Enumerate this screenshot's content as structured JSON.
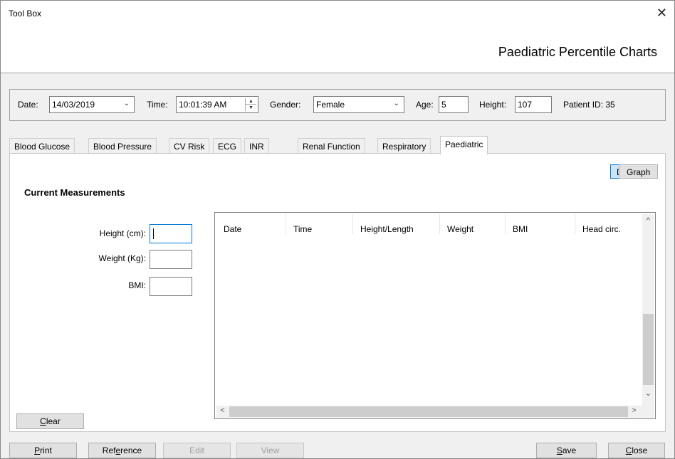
{
  "window": {
    "title": "Tool Box",
    "close_icon": "close-icon"
  },
  "header": {
    "title": "Paediatric Percentile Charts"
  },
  "filters": {
    "date_label": "Date:",
    "date_value": "14/03/2019",
    "time_label": "Time:",
    "time_value": "10:01:39 AM",
    "gender_label": "Gender:",
    "gender_value": "Female",
    "age_label": "Age:",
    "age_value": "5",
    "height_label": "Height:",
    "height_value": "107",
    "patient_id_label": "Patient ID: 35"
  },
  "tabs": [
    {
      "label": "Blood Glucose"
    },
    {
      "label": "Blood Pressure"
    },
    {
      "label": "CV Risk"
    },
    {
      "label": "ECG"
    },
    {
      "label": "INR"
    },
    {
      "label": "Renal Function"
    },
    {
      "label": "Respiratory"
    },
    {
      "label": "Paediatric",
      "active": true
    }
  ],
  "view_toggle": {
    "data_label": "Data",
    "graph_label": "Graph",
    "selected": "Data"
  },
  "measurements": {
    "title": "Current Measurements",
    "height_label": "Height (cm):",
    "weight_label": "Weight (Kg):",
    "bmi_label": "BMI:",
    "height_value": "",
    "weight_value": "",
    "bmi_value": ""
  },
  "table": {
    "columns": [
      "Date",
      "Time",
      "Height/Length",
      "Weight",
      "BMI",
      "Head circ."
    ],
    "rows": []
  },
  "buttons": {
    "clear": {
      "pre": "",
      "u": "C",
      "post": "lear"
    },
    "print": {
      "pre": "",
      "u": "P",
      "post": "rint"
    },
    "reference": {
      "pre": "Ref",
      "u": "e",
      "post": "rence"
    },
    "edit": "Edit",
    "view": "View",
    "save": {
      "pre": "",
      "u": "S",
      "post": "ave"
    },
    "close": {
      "pre": "",
      "u": "C",
      "post": "lose"
    }
  },
  "colors": {
    "accent": "#0078d7",
    "toggle_selected": "#cce4f7",
    "panel_bg": "#ffffff",
    "window_bg": "#f0f0f0"
  }
}
